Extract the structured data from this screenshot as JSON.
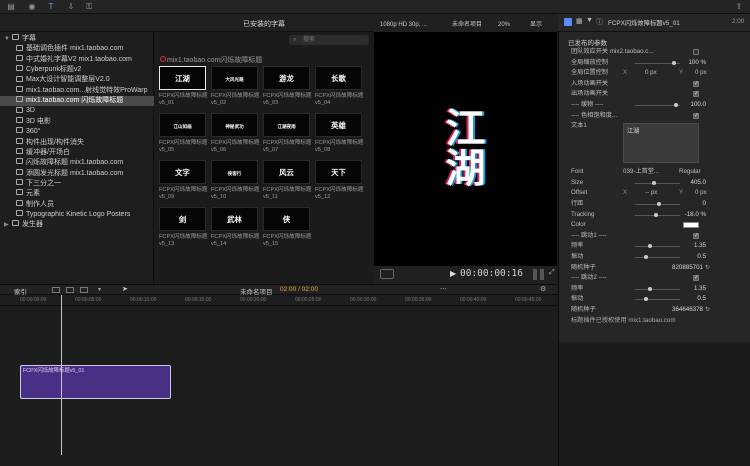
{
  "browser": {
    "heading": "已安装的字幕",
    "search_placeholder": "搜索",
    "section_title": "mix1.taobao.com闪烁故障标题",
    "thumbnails": [
      {
        "label": "FCPX闪烁故障标题v5_01",
        "art": "江湖"
      },
      {
        "label": "FCPX闪烁故障标题v5_02",
        "art": "大风光路"
      },
      {
        "label": "FCPX闪烁故障标题v5_03",
        "art": "游龙"
      },
      {
        "label": "FCPX闪烁故障标题v5_04",
        "art": "长歌"
      },
      {
        "label": "FCPX闪烁故障标题v5_05",
        "art": "江山如画"
      },
      {
        "label": "FCPX闪烁故障标题v5_06",
        "art": "神秘武功"
      },
      {
        "label": "FCPX闪烁故障标题v5_07",
        "art": "江湖夜雨"
      },
      {
        "label": "FCPX闪烁故障标题v5_08",
        "art": "英雄"
      },
      {
        "label": "FCPX闪烁故障标题v5_09",
        "art": "文字"
      },
      {
        "label": "FCPX闪烁故障标题v5_10",
        "art": "侠客行"
      },
      {
        "label": "FCPX闪烁故障标题v5_11",
        "art": "风云"
      },
      {
        "label": "FCPX闪烁故障标题v5_12",
        "art": "天下"
      },
      {
        "label": "FCPX闪烁故障标题v5_13",
        "art": "剑"
      },
      {
        "label": "FCPX闪烁故障标题v5_14",
        "art": "武林"
      },
      {
        "label": "FCPX闪烁故障标题v5_15",
        "art": "侠"
      }
    ]
  },
  "sidebar": {
    "items": [
      {
        "label": "字幕",
        "level": 0,
        "open": true
      },
      {
        "label": "基础调色插件 mix1.taobao.com",
        "level": 1
      },
      {
        "label": "中式婚礼字幕V2 mix1.taobao.com",
        "level": 1
      },
      {
        "label": "Cyberpunk标题v2",
        "level": 1
      },
      {
        "label": "Max大设计智能调整层V2.0",
        "level": 1
      },
      {
        "label": "mix1.taobao.com...射线觉特效ProWarp",
        "level": 1
      },
      {
        "label": "mix1.taobao.com 闪烁故障标题",
        "level": 1,
        "selected": true
      },
      {
        "label": "3D",
        "level": 1
      },
      {
        "label": "3D 电影",
        "level": 1
      },
      {
        "label": "360°",
        "level": 1
      },
      {
        "label": "构件出现/构件消失",
        "level": 1
      },
      {
        "label": "缓冲器/开场白",
        "level": 1
      },
      {
        "label": "闪烁故障标题 mix1.taobao.com",
        "level": 1
      },
      {
        "label": "添圆发光标题 mix1.taobao.com",
        "level": 1
      },
      {
        "label": "下三分之一",
        "level": 1
      },
      {
        "label": "元素",
        "level": 1
      },
      {
        "label": "制作人员",
        "level": 1
      },
      {
        "label": "Typographic Kinetic Logo Posters",
        "level": 1
      },
      {
        "label": "发生器",
        "level": 0,
        "open": false
      }
    ]
  },
  "viewer": {
    "format": "1080p HD 30p, ...",
    "project": "未命名项目",
    "zoom": "20%",
    "display": "显示",
    "preview_text": "江湖",
    "timecode": "00:00:00:16"
  },
  "inspector": {
    "title": "FCPX闪烁故障标题v5_01",
    "time": "2:00",
    "section": "已发布的参数",
    "rows": [
      {
        "label": "团队效应开关 mix2.taobao.c...",
        "type": "check",
        "on": false
      },
      {
        "label": "全局缩放控制",
        "type": "slider",
        "value": "100 %",
        "knob": 0.85
      },
      {
        "label": "全局位置控制",
        "type": "xy",
        "x": "0 px",
        "y": "0 px"
      },
      {
        "label": "入场动画开关",
        "type": "check",
        "on": true
      },
      {
        "label": "出场动画开关",
        "type": "check",
        "on": true
      },
      {
        "label": "---- 缓物 ----",
        "type": "slider",
        "value": "100.0",
        "knob": 0.9
      },
      {
        "label": "---- 色相饱和度...",
        "type": "check",
        "on": true
      },
      {
        "label": "文本1",
        "type": "text",
        "value": "江湖"
      },
      {
        "label": "Font",
        "type": "font",
        "value": "039-上首堂...",
        "style": "Regular"
      },
      {
        "label": "Size",
        "type": "slider",
        "value": "405.0",
        "knob": 0.4
      },
      {
        "label": "Offset",
        "type": "xy",
        "x": "-- px",
        "y": "0 px"
      },
      {
        "label": "行距",
        "type": "slider",
        "value": "0",
        "knob": 0.5
      },
      {
        "label": "Tracking",
        "type": "slider",
        "value": "-18.0 %",
        "knob": 0.45
      },
      {
        "label": "Color",
        "type": "color",
        "value": "#ffffff"
      },
      {
        "label": "---- 跳动1 ----",
        "type": "check",
        "on": true
      },
      {
        "label": "频率",
        "type": "slider",
        "value": "1.35",
        "knob": 0.3
      },
      {
        "label": "振动",
        "type": "slider",
        "value": "0.5",
        "knob": 0.2
      },
      {
        "label": "随机种子",
        "type": "seed",
        "value": "820885701"
      },
      {
        "label": "---- 跳动2 ----",
        "type": "check",
        "on": true
      },
      {
        "label": "频率",
        "type": "slider",
        "value": "1.35",
        "knob": 0.3
      },
      {
        "label": "振动",
        "type": "slider",
        "value": "0.5",
        "knob": 0.2
      },
      {
        "label": "随机种子",
        "type": "seed",
        "value": "364646378"
      },
      {
        "label": "标题插件已授权使用 mix1.taobao.com",
        "type": "note"
      }
    ]
  },
  "timeline": {
    "index_label": "索引",
    "project": "未命名项目",
    "time": "02:00 / 02:00",
    "ruler_marks": [
      "00:00:00:00",
      "00:00:05:00",
      "00:00:10:00",
      "00:00:15:00",
      "00:00:20:00",
      "00:00:25:00",
      "00:00:30:00",
      "00:00:35:00",
      "00:00:40:00",
      "00:00:45:00"
    ],
    "clip_label": "FCPX闪烁故障标题v5_01"
  }
}
